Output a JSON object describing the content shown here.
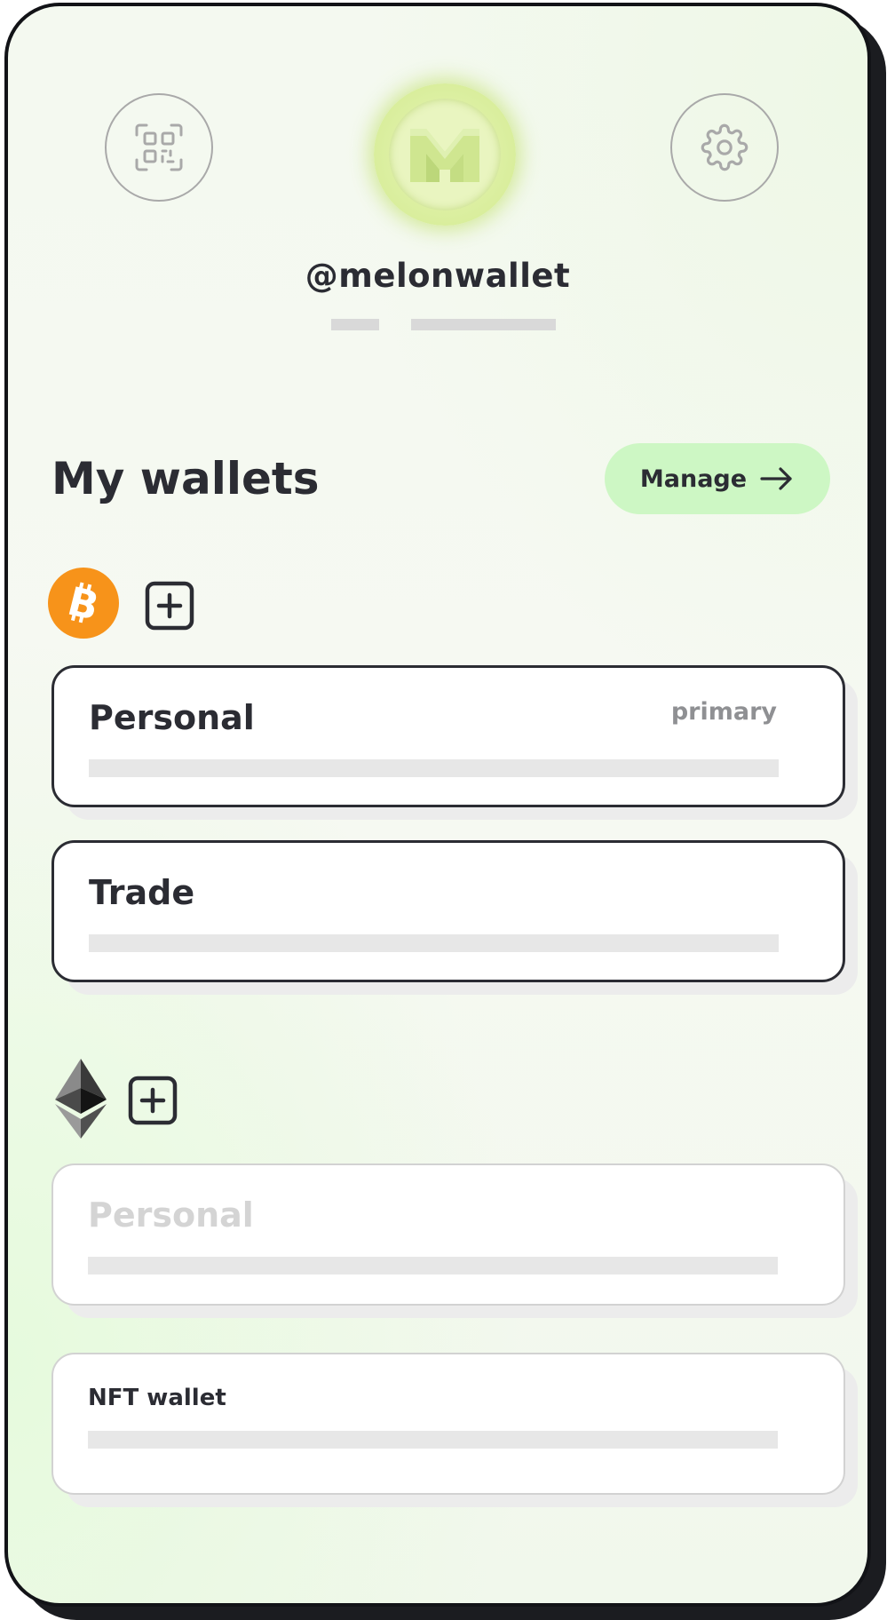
{
  "profile": {
    "handle": "@melonwallet"
  },
  "header": {
    "scan_icon": "qr-code-scan-icon",
    "settings_icon": "gear-icon",
    "logo_icon": "melon-m-logo"
  },
  "wallets": {
    "title": "My wallets",
    "manage_label": "Manage",
    "bitcoin": {
      "coin_icon": "bitcoin-icon",
      "items": [
        {
          "name": "Personal",
          "tag": "primary"
        },
        {
          "name": "Trade"
        }
      ]
    },
    "ethereum": {
      "coin_icon": "ethereum-icon",
      "items": [
        {
          "name": "Personal"
        },
        {
          "name": "NFT wallet"
        }
      ]
    }
  },
  "colors": {
    "accent": "#cdf7c4",
    "bitcoin": "#f7931a",
    "text": "#2b2c33",
    "logo": "#d3ea92"
  }
}
